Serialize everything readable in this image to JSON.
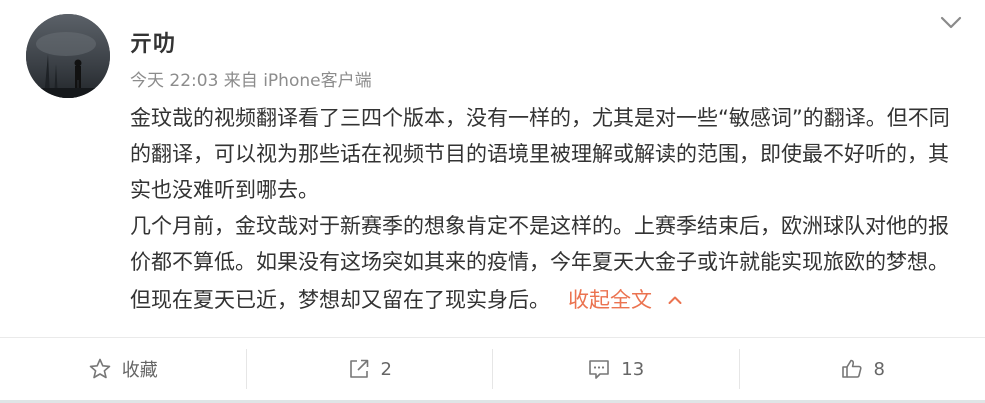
{
  "post": {
    "username": "亓叻",
    "meta": "今天 22:03 来自 iPhone客户端",
    "paragraphs": [
      "金玟哉的视频翻译看了三四个版本，没有一样的，尤其是对一些“敏感词”的翻译。但不同的翻译，可以视为那些话在视频节目的语境里被理解或解读的范围，即使最不好听的，其实也没难听到哪去。",
      "几个月前，金玟哉对于新赛季的想象肯定不是这样的。上赛季结束后，欧洲球队对他的报价都不算低。如果没有这场突如其来的疫情，今年夏天大金子或许就能实现旅欧的梦想。但现在夏天已近，梦想却又留在了现实身后。"
    ],
    "collapse_label": "收起全文",
    "accent_color": "#eb7350"
  },
  "actions": {
    "favorite": {
      "icon": "star-icon",
      "label": "收藏"
    },
    "repost": {
      "icon": "share-icon",
      "count": "2"
    },
    "comment": {
      "icon": "comment-icon",
      "count": "13"
    },
    "like": {
      "icon": "thumbs-up-icon",
      "count": "8"
    }
  }
}
